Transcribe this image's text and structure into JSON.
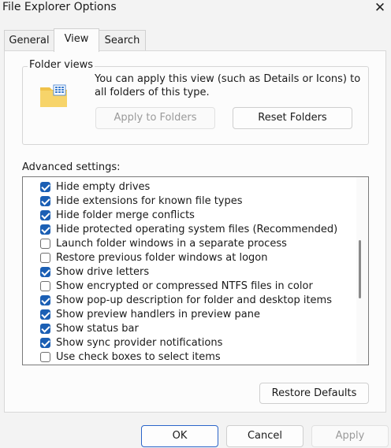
{
  "window": {
    "title": "File Explorer Options"
  },
  "tabs": [
    {
      "label": "General"
    },
    {
      "label": "View"
    },
    {
      "label": "Search"
    }
  ],
  "folder_views": {
    "label": "Folder views",
    "description": "You can apply this view (such as Details or Icons) to all folders of this type.",
    "apply_label": "Apply to Folders",
    "reset_label": "Reset Folders"
  },
  "advanced": {
    "label": "Advanced settings:",
    "items": [
      {
        "label": "Hide empty drives",
        "checked": true
      },
      {
        "label": "Hide extensions for known file types",
        "checked": true
      },
      {
        "label": "Hide folder merge conflicts",
        "checked": true
      },
      {
        "label": "Hide protected operating system files (Recommended)",
        "checked": true
      },
      {
        "label": "Launch folder windows in a separate process",
        "checked": false
      },
      {
        "label": "Restore previous folder windows at logon",
        "checked": false
      },
      {
        "label": "Show drive letters",
        "checked": true
      },
      {
        "label": "Show encrypted or compressed NTFS files in color",
        "checked": false
      },
      {
        "label": "Show pop-up description for folder and desktop items",
        "checked": true
      },
      {
        "label": "Show preview handlers in preview pane",
        "checked": true
      },
      {
        "label": "Show status bar",
        "checked": true
      },
      {
        "label": "Show sync provider notifications",
        "checked": true
      },
      {
        "label": "Use check boxes to select items",
        "checked": false
      }
    ],
    "restore_label": "Restore Defaults"
  },
  "footer": {
    "ok": "OK",
    "cancel": "Cancel",
    "apply": "Apply"
  },
  "colors": {
    "accent": "#1b5fb4",
    "window_bg": "#f3f3f3",
    "panel_bg": "#fcfcfc"
  }
}
